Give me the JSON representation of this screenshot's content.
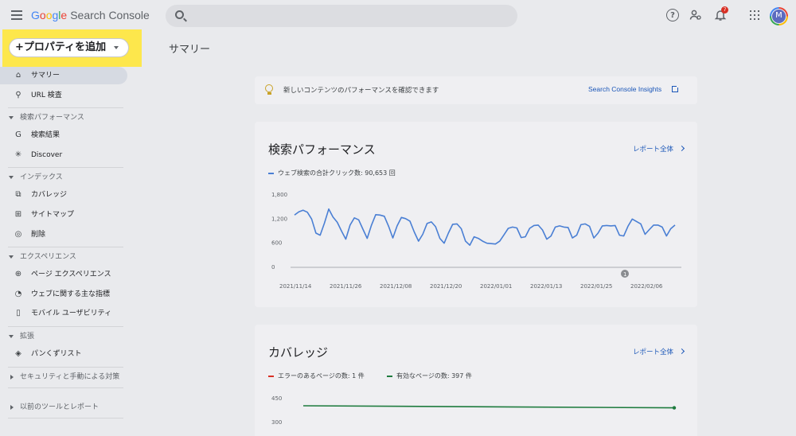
{
  "header": {
    "logo_letters": [
      "G",
      "o",
      "o",
      "g",
      "l",
      "e"
    ],
    "app_name": "Search Console",
    "notification_count": "7",
    "avatar_initial": "M",
    "icons": [
      "menu-icon",
      "search-icon",
      "help-icon",
      "users-icon",
      "bell-icon",
      "apps-icon"
    ]
  },
  "sidebar": {
    "property_button": "+プロパティを追加",
    "items": [
      {
        "label": "サマリー",
        "icon": "home-icon",
        "glyph": "⌂",
        "active": true
      },
      {
        "label": "URL 検査",
        "icon": "search-icon",
        "glyph": "⚲"
      }
    ],
    "sections": [
      {
        "title": "検索パフォーマンス",
        "items": [
          {
            "label": "検索結果",
            "icon": "google-g-icon",
            "glyph": "G"
          },
          {
            "label": "Discover",
            "icon": "asterisk-icon",
            "glyph": "✳"
          }
        ]
      },
      {
        "title": "インデックス",
        "items": [
          {
            "label": "カバレッジ",
            "icon": "pages-icon",
            "glyph": "⧉"
          },
          {
            "label": "サイトマップ",
            "icon": "sitemap-icon",
            "glyph": "⊞"
          },
          {
            "label": "削除",
            "icon": "eye-off-icon",
            "glyph": "◎"
          }
        ]
      },
      {
        "title": "エクスペリエンス",
        "items": [
          {
            "label": "ページ エクスペリエンス",
            "icon": "plus-circle-icon",
            "glyph": "⊕"
          },
          {
            "label": "ウェブに関する主な指標",
            "icon": "gauge-icon",
            "glyph": "◔"
          },
          {
            "label": "モバイル ユーザビリティ",
            "icon": "phone-icon",
            "glyph": "▯"
          }
        ]
      },
      {
        "title": "拡張",
        "items": [
          {
            "label": "パンくずリスト",
            "icon": "layers-icon",
            "glyph": "◈"
          }
        ]
      },
      {
        "title": "セキュリティと手動による対策",
        "items": []
      },
      {
        "title": "以前のツールとレポート",
        "items": []
      }
    ]
  },
  "main": {
    "page_title": "サマリー",
    "insights": {
      "text": "新しいコンテンツのパフォーマンスを確認できます",
      "link": "Search Console Insights"
    },
    "performance": {
      "title": "検索パフォーマンス",
      "link": "レポート全体",
      "legend": "ウェブ検索の合計クリック数: 90,653 回",
      "annotation": "1"
    },
    "coverage": {
      "title": "カバレッジ",
      "link": "レポート全体",
      "legend_error": "エラーのあるページの数: 1 件",
      "legend_valid": "有効なページの数: 397 件"
    }
  },
  "chart_data": [
    {
      "type": "line",
      "series": [
        {
          "name": "ウェブ検索の合計クリック数: 90,653 回",
          "color": "#4a7fd4",
          "values": [
            1300,
            1380,
            1420,
            1370,
            1200,
            850,
            800,
            1100,
            1450,
            1250,
            1120,
            900,
            700,
            1050,
            1230,
            1180,
            950,
            720,
            1050,
            1310,
            1300,
            1270,
            1020,
            730,
            1030,
            1240,
            1210,
            1150,
            880,
            650,
            820,
            1090,
            1130,
            1010,
            720,
            600,
            850,
            1070,
            1080,
            960,
            650,
            550,
            760,
            720,
            650,
            600,
            590,
            580,
            650,
            810,
            970,
            1000,
            980,
            740,
            760,
            970,
            1040,
            1050,
            930,
            700,
            780,
            1000,
            1030,
            1000,
            990,
            730,
            800,
            1060,
            1080,
            1020,
            730,
            850,
            1030,
            1040,
            1030,
            1040,
            800,
            780,
            1020,
            1200,
            1140,
            1080,
            820,
            940,
            1050,
            1050,
            1000,
            780,
            960,
            1050
          ]
        }
      ],
      "x_ticks": [
        "2021/11/14",
        "2021/11/26",
        "2021/12/08",
        "2021/12/20",
        "2022/01/01",
        "2022/01/13",
        "2022/01/25",
        "2022/02/06"
      ],
      "y_ticks": [
        "1,800",
        "1,200",
        "600",
        "0"
      ],
      "ylim": [
        0,
        1800
      ]
    },
    {
      "type": "line",
      "series": [
        {
          "name": "エラーのあるページの数: 1 件",
          "color": "#d93025",
          "values": [
            1,
            1
          ]
        },
        {
          "name": "有効なページの数: 397 件",
          "color": "#1e7b3e",
          "values": [
            370,
            397
          ]
        }
      ],
      "y_ticks": [
        "450",
        "300"
      ],
      "ylim": [
        0,
        450
      ]
    }
  ],
  "colors": {
    "accent": "#1a56b8",
    "highlight": "#fde74c",
    "series_blue": "#4a7fd4",
    "series_green": "#1e7b3e",
    "series_red": "#d93025"
  }
}
